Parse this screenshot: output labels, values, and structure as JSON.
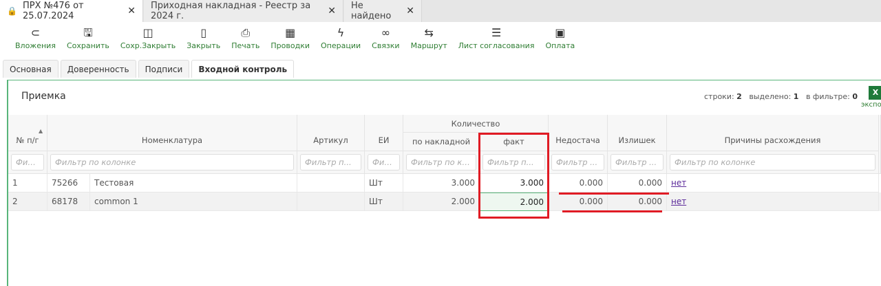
{
  "window_tabs": [
    {
      "label": "ПРХ №476 от 25.07.2024",
      "icon": "lock-icon",
      "active": true
    },
    {
      "label": "Приходная накладная - Реестр за 2024 г.",
      "active": false
    },
    {
      "label": "Не найдено",
      "active": false
    }
  ],
  "close_glyph": "✕",
  "toolbar": [
    {
      "label": "Вложения",
      "icon": "paperclip-icon",
      "glyph": "⊂"
    },
    {
      "label": "Сохранить",
      "icon": "save-icon",
      "glyph": "🖫"
    },
    {
      "label": "Сохр.Закрыть",
      "icon": "save-close-icon",
      "glyph": "◫"
    },
    {
      "label": "Закрыть",
      "icon": "door-icon",
      "glyph": "▯"
    },
    {
      "label": "Печать",
      "icon": "printer-icon",
      "glyph": "⎙"
    },
    {
      "label": "Проводки",
      "icon": "calculator-icon",
      "glyph": "▦"
    },
    {
      "label": "Операции",
      "icon": "lightning-icon",
      "glyph": "ϟ"
    },
    {
      "label": "Связки",
      "icon": "link-icon",
      "glyph": "∞"
    },
    {
      "label": "Маршрут",
      "icon": "route-icon",
      "glyph": "⇆"
    },
    {
      "label": "Лист согласования",
      "icon": "checklist-icon",
      "glyph": "☰"
    },
    {
      "label": "Оплата",
      "icon": "payment-icon",
      "glyph": "▣"
    }
  ],
  "sub_tabs": [
    "Основная",
    "Доверенность",
    "Подписи",
    "Входной контроль"
  ],
  "active_sub_tab": "Входной контроль",
  "panel": {
    "title": "Приемка",
    "stats": {
      "rows_label": "строки:",
      "rows": "2",
      "selected_label": "выделено:",
      "selected": "1",
      "filter_label": "в фильтре:",
      "filter": "0"
    },
    "export_icon": "X",
    "export_label": "экспо"
  },
  "table": {
    "group_header": "Количество",
    "sort_glyph": "▲",
    "columns": [
      "№ п/г",
      "Номенклатура",
      "Артикул",
      "ЕИ",
      "по накладной",
      "факт",
      "Недостача",
      "Излишек",
      "Причины расхождения"
    ],
    "filters": [
      "Фил...",
      "Фильтр по колонке",
      "Фильтр п...",
      "Фил...",
      "Фильтр по ко...",
      "Фильтр п...",
      "Фильтр ...",
      "Фильтр ...",
      "Фильтр по колонке"
    ],
    "rows": [
      {
        "num": "1",
        "code": "75266",
        "name": "Тестовая",
        "article": "",
        "unit": "Шт",
        "by_invoice": "3.000",
        "fact": "3.000",
        "shortage": "0.000",
        "surplus": "0.000",
        "reason": "нет"
      },
      {
        "num": "2",
        "code": "68178",
        "name": "common 1",
        "article": "",
        "unit": "Шт",
        "by_invoice": "2.000",
        "fact": "2.000",
        "shortage": "0.000",
        "surplus": "0.000",
        "reason": "нет"
      }
    ]
  },
  "colors": {
    "accent_green": "#2e7d32",
    "panel_border": "#58b57a",
    "annotation_red": "#e01b24",
    "link": "#5b2a9a"
  }
}
